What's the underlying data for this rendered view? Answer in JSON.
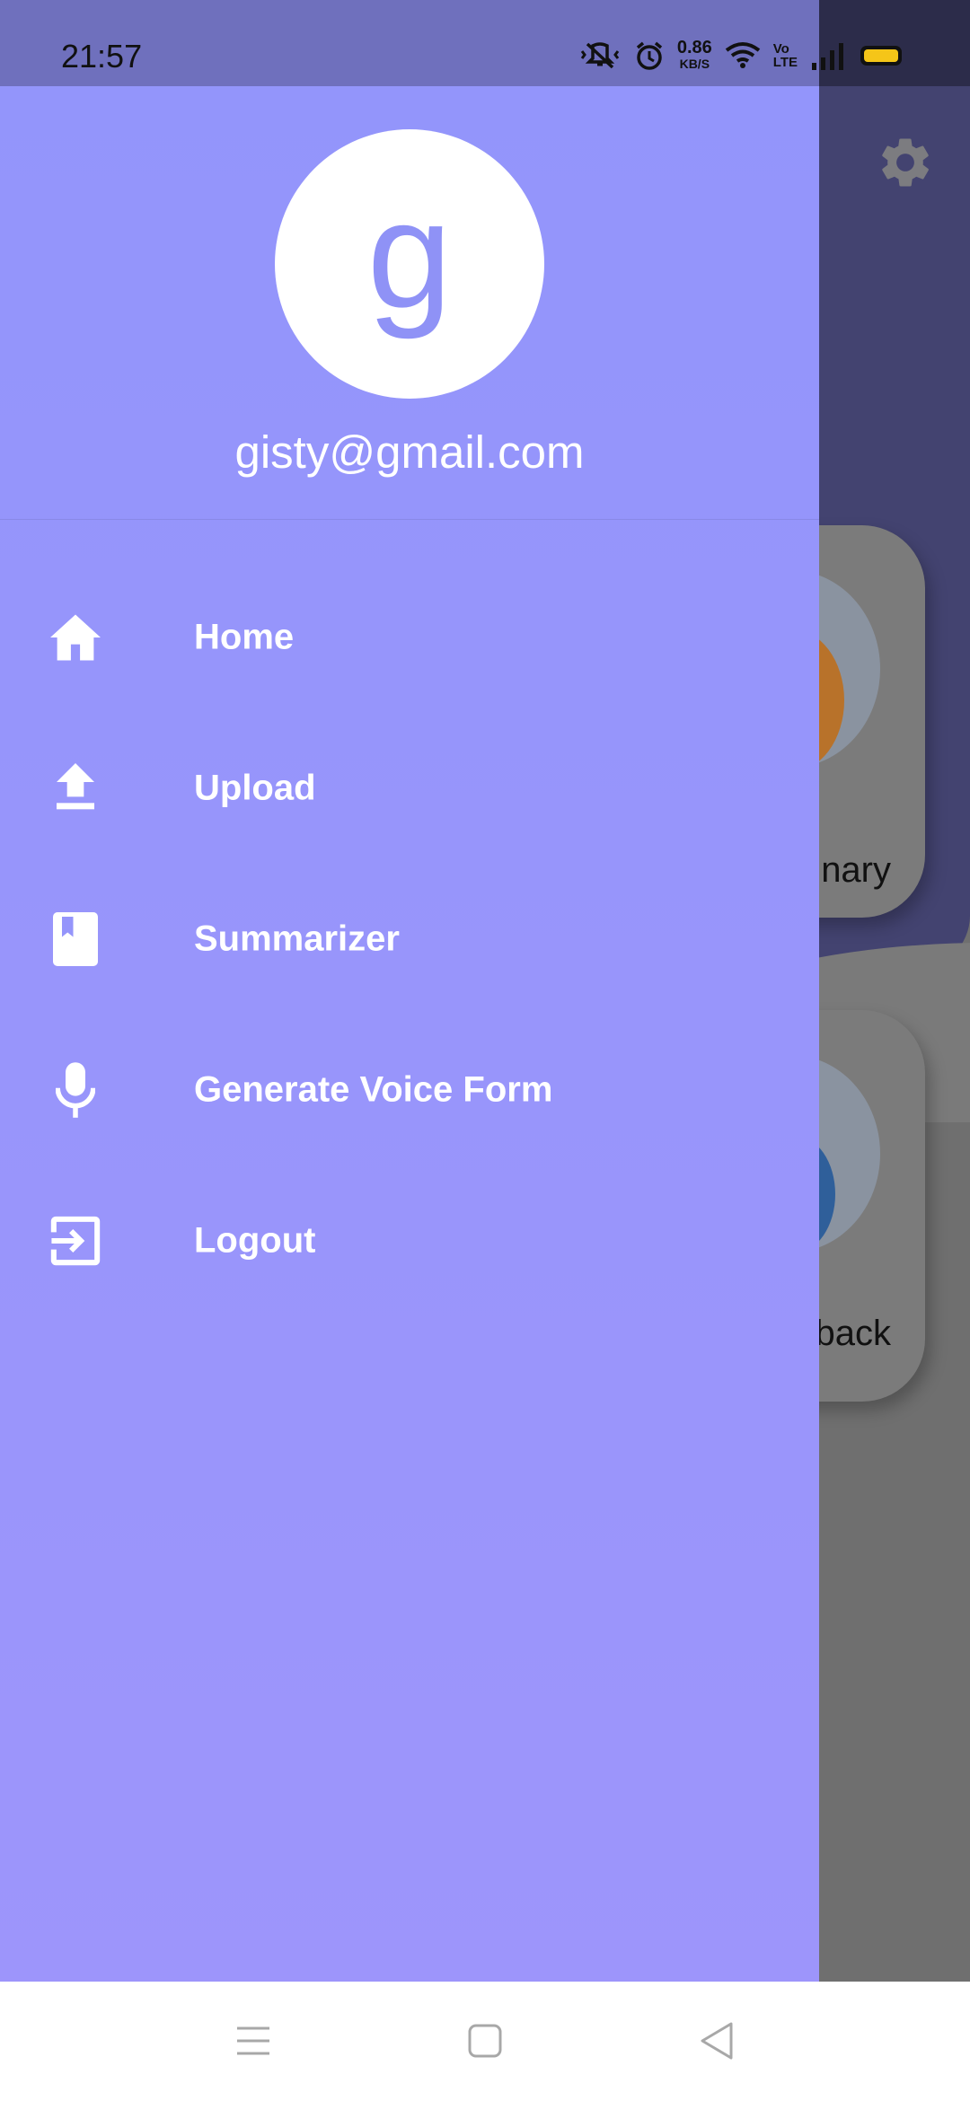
{
  "status_bar": {
    "time": "21:57",
    "net_speed_value": "0.86",
    "net_speed_unit": "KB/S",
    "volte_top": "Vo",
    "volte_bottom": "LTE",
    "battery_color": "#f5c518"
  },
  "drawer": {
    "avatar_letter": "g",
    "email": "gisty@gmail.com",
    "items": [
      {
        "label": "Home",
        "icon": "home-icon"
      },
      {
        "label": "Upload",
        "icon": "upload-icon"
      },
      {
        "label": "Summarizer",
        "icon": "book-icon"
      },
      {
        "label": "Generate Voice Form",
        "icon": "microphone-icon"
      },
      {
        "label": "Logout",
        "icon": "logout-icon"
      }
    ],
    "color_top": "#9395fb",
    "color_bottom": "#9d95fb"
  },
  "background_app": {
    "card_labels": [
      "nary",
      "back"
    ]
  },
  "nav_bar": {
    "buttons": [
      "menu-icon",
      "home-square-icon",
      "back-triangle-icon"
    ]
  }
}
